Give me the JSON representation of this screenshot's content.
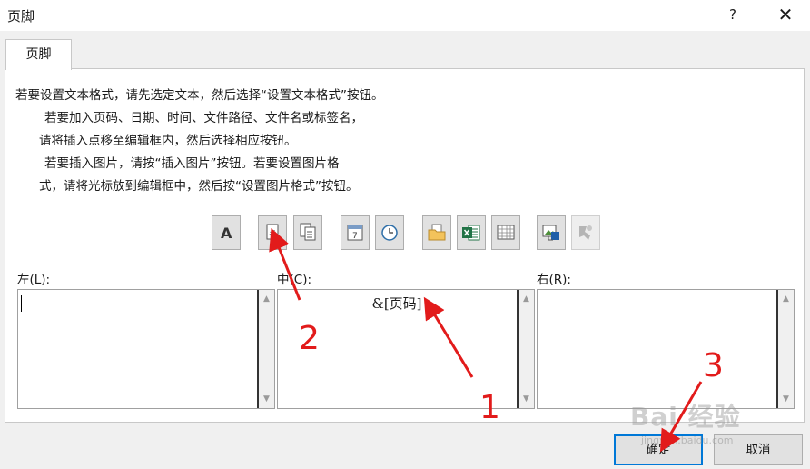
{
  "dialog": {
    "title": "页脚",
    "help_glyph": "?",
    "close_glyph": "✕"
  },
  "tab": {
    "label": "页脚"
  },
  "instructions": [
    "若要设置文本格式，请先选定文本，然后选择“设置文本格式”按钮。",
    "若要加入页码、日期、时间、文件路径、文件名或标签名，",
    "请将插入点移至编辑框内，然后选择相应按钮。",
    "若要插入图片，请按“插入图片”按钮。若要设置图片格",
    "式，请将光标放到编辑框中，然后按“设置图片格式”按钮。"
  ],
  "toolbar": {
    "format_text_glyph": "A",
    "page_number_glyph": "#",
    "date_glyph": "7",
    "icons": [
      "format-text-icon",
      "insert-page-number-icon",
      "insert-page-count-icon",
      "insert-date-icon",
      "insert-time-icon",
      "insert-file-path-icon",
      "insert-file-name-icon",
      "insert-sheet-name-icon",
      "insert-picture-icon",
      "format-picture-icon"
    ]
  },
  "sections": {
    "left": {
      "label": "左(L):",
      "content": ""
    },
    "center": {
      "label": "中(C):",
      "content": "&[页码]"
    },
    "right": {
      "label": "右(R):",
      "content": ""
    }
  },
  "buttons": {
    "ok": "确定",
    "cancel": "取消"
  },
  "annotations": {
    "one": "1",
    "two": "2",
    "three": "3"
  },
  "watermark": {
    "main": "Bai 经验",
    "url": "jingyan.baidu.com"
  },
  "colors": {
    "accent": "#0078d7",
    "annotation": "#e21b1b"
  }
}
